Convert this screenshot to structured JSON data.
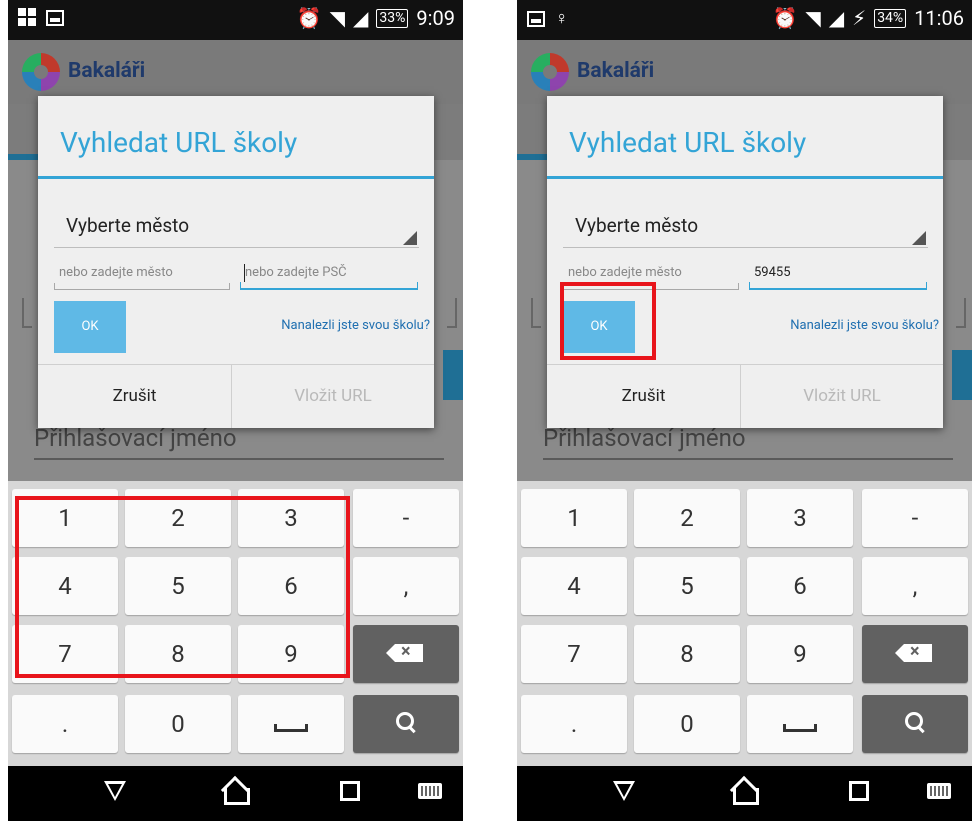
{
  "phones": [
    {
      "status_time": "9:09",
      "battery": "33%",
      "app_title": "Bakaláři",
      "dialog": {
        "title": "Vyhledat URL školy",
        "spinner_label": "Vyberte město",
        "city_placeholder": "nebo zadejte město",
        "psc_placeholder": "nebo zadejte PSČ",
        "psc_value": "",
        "ok_label": "OK",
        "found_link": "Nanalezli jste svou školu?",
        "cancel_label": "Zrušit",
        "insert_label": "Vložit URL"
      },
      "background_login_label": "Přihlašovací jméno"
    },
    {
      "status_time": "11:06",
      "battery": "34%",
      "app_title": "Bakaláři",
      "dialog": {
        "title": "Vyhledat URL školy",
        "spinner_label": "Vyberte město",
        "city_placeholder": "nebo zadejte město",
        "psc_placeholder": "",
        "psc_value": "59455",
        "ok_label": "OK",
        "found_link": "Nanalezli jste svou školu?",
        "cancel_label": "Zrušit",
        "insert_label": "Vložit URL"
      },
      "background_login_label": "Přihlašovací jméno"
    }
  ],
  "keyboard": {
    "rows": [
      [
        "1",
        "2",
        "3",
        "-"
      ],
      [
        "4",
        "5",
        "6",
        ","
      ],
      [
        "7",
        "8",
        "9",
        "backspace"
      ],
      [
        ".",
        "0",
        "space",
        "search"
      ]
    ]
  },
  "colors": {
    "accent": "#33a4d6",
    "ok_button": "#5fb9e6",
    "highlight": "#e8141b",
    "link": "#1f6fb0"
  },
  "icons": {
    "nav": [
      "back-icon",
      "home-icon",
      "recent-apps-icon",
      "keyboard-icon"
    ],
    "status": [
      "alarm-icon",
      "wifi-icon",
      "signal-icon",
      "battery-icon"
    ]
  }
}
